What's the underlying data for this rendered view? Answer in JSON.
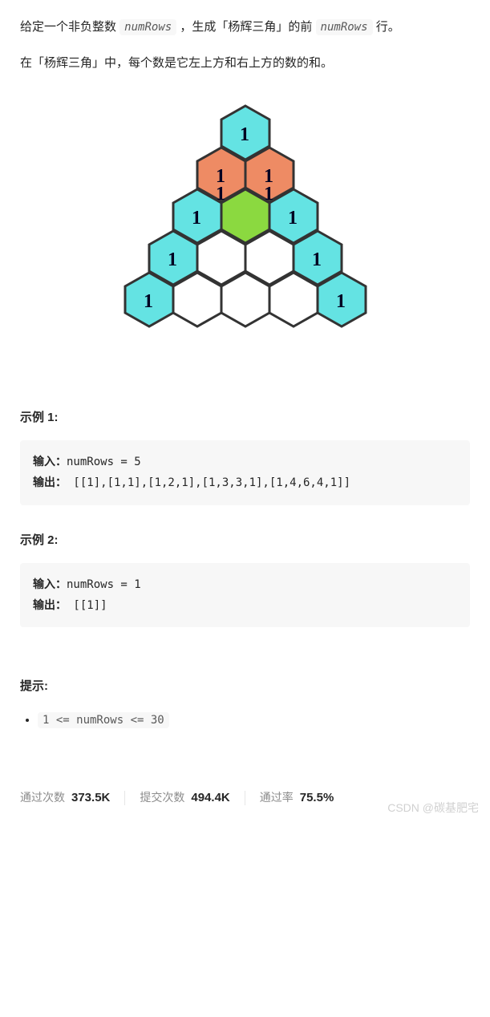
{
  "description": {
    "line1_a": "给定一个非负整数 ",
    "code1": "numRows",
    "line1_b": "，生成「杨辉三角」的前 ",
    "code2": "numRows",
    "line1_c": " 行。",
    "line2": "在「杨辉三角」中，每个数是它左上方和右上方的数的和。"
  },
  "diagram_values": {
    "r0": [
      "1"
    ],
    "r1": [
      "1",
      "1"
    ],
    "r2": [
      "1",
      "1",
      "1",
      "1"
    ],
    "r3": [
      "1",
      "",
      "1"
    ],
    "r4": [
      "1",
      "",
      "",
      "1"
    ],
    "r5": [
      "1",
      "",
      "",
      "",
      "1"
    ]
  },
  "example1_title": "示例 1:",
  "example1": {
    "input_label": "输入：",
    "input_val": "numRows = 5",
    "output_label": "输出：",
    "output_val": " [[1],[1,1],[1,2,1],[1,3,3,1],[1,4,6,4,1]]"
  },
  "example2_title": "示例 2:",
  "example2": {
    "input_label": "输入：",
    "input_val": "numRows = 1",
    "output_label": "输出：",
    "output_val": " [[1]]"
  },
  "hints_title": "提示:",
  "constraint": "1 <= numRows <= 30",
  "stats": {
    "pass_label": "通过次数",
    "pass_val": "373.5K",
    "submit_label": "提交次数",
    "submit_val": "494.4K",
    "rate_label": "通过率",
    "rate_val": "75.5%"
  },
  "watermark": "CSDN @碳基肥宅"
}
